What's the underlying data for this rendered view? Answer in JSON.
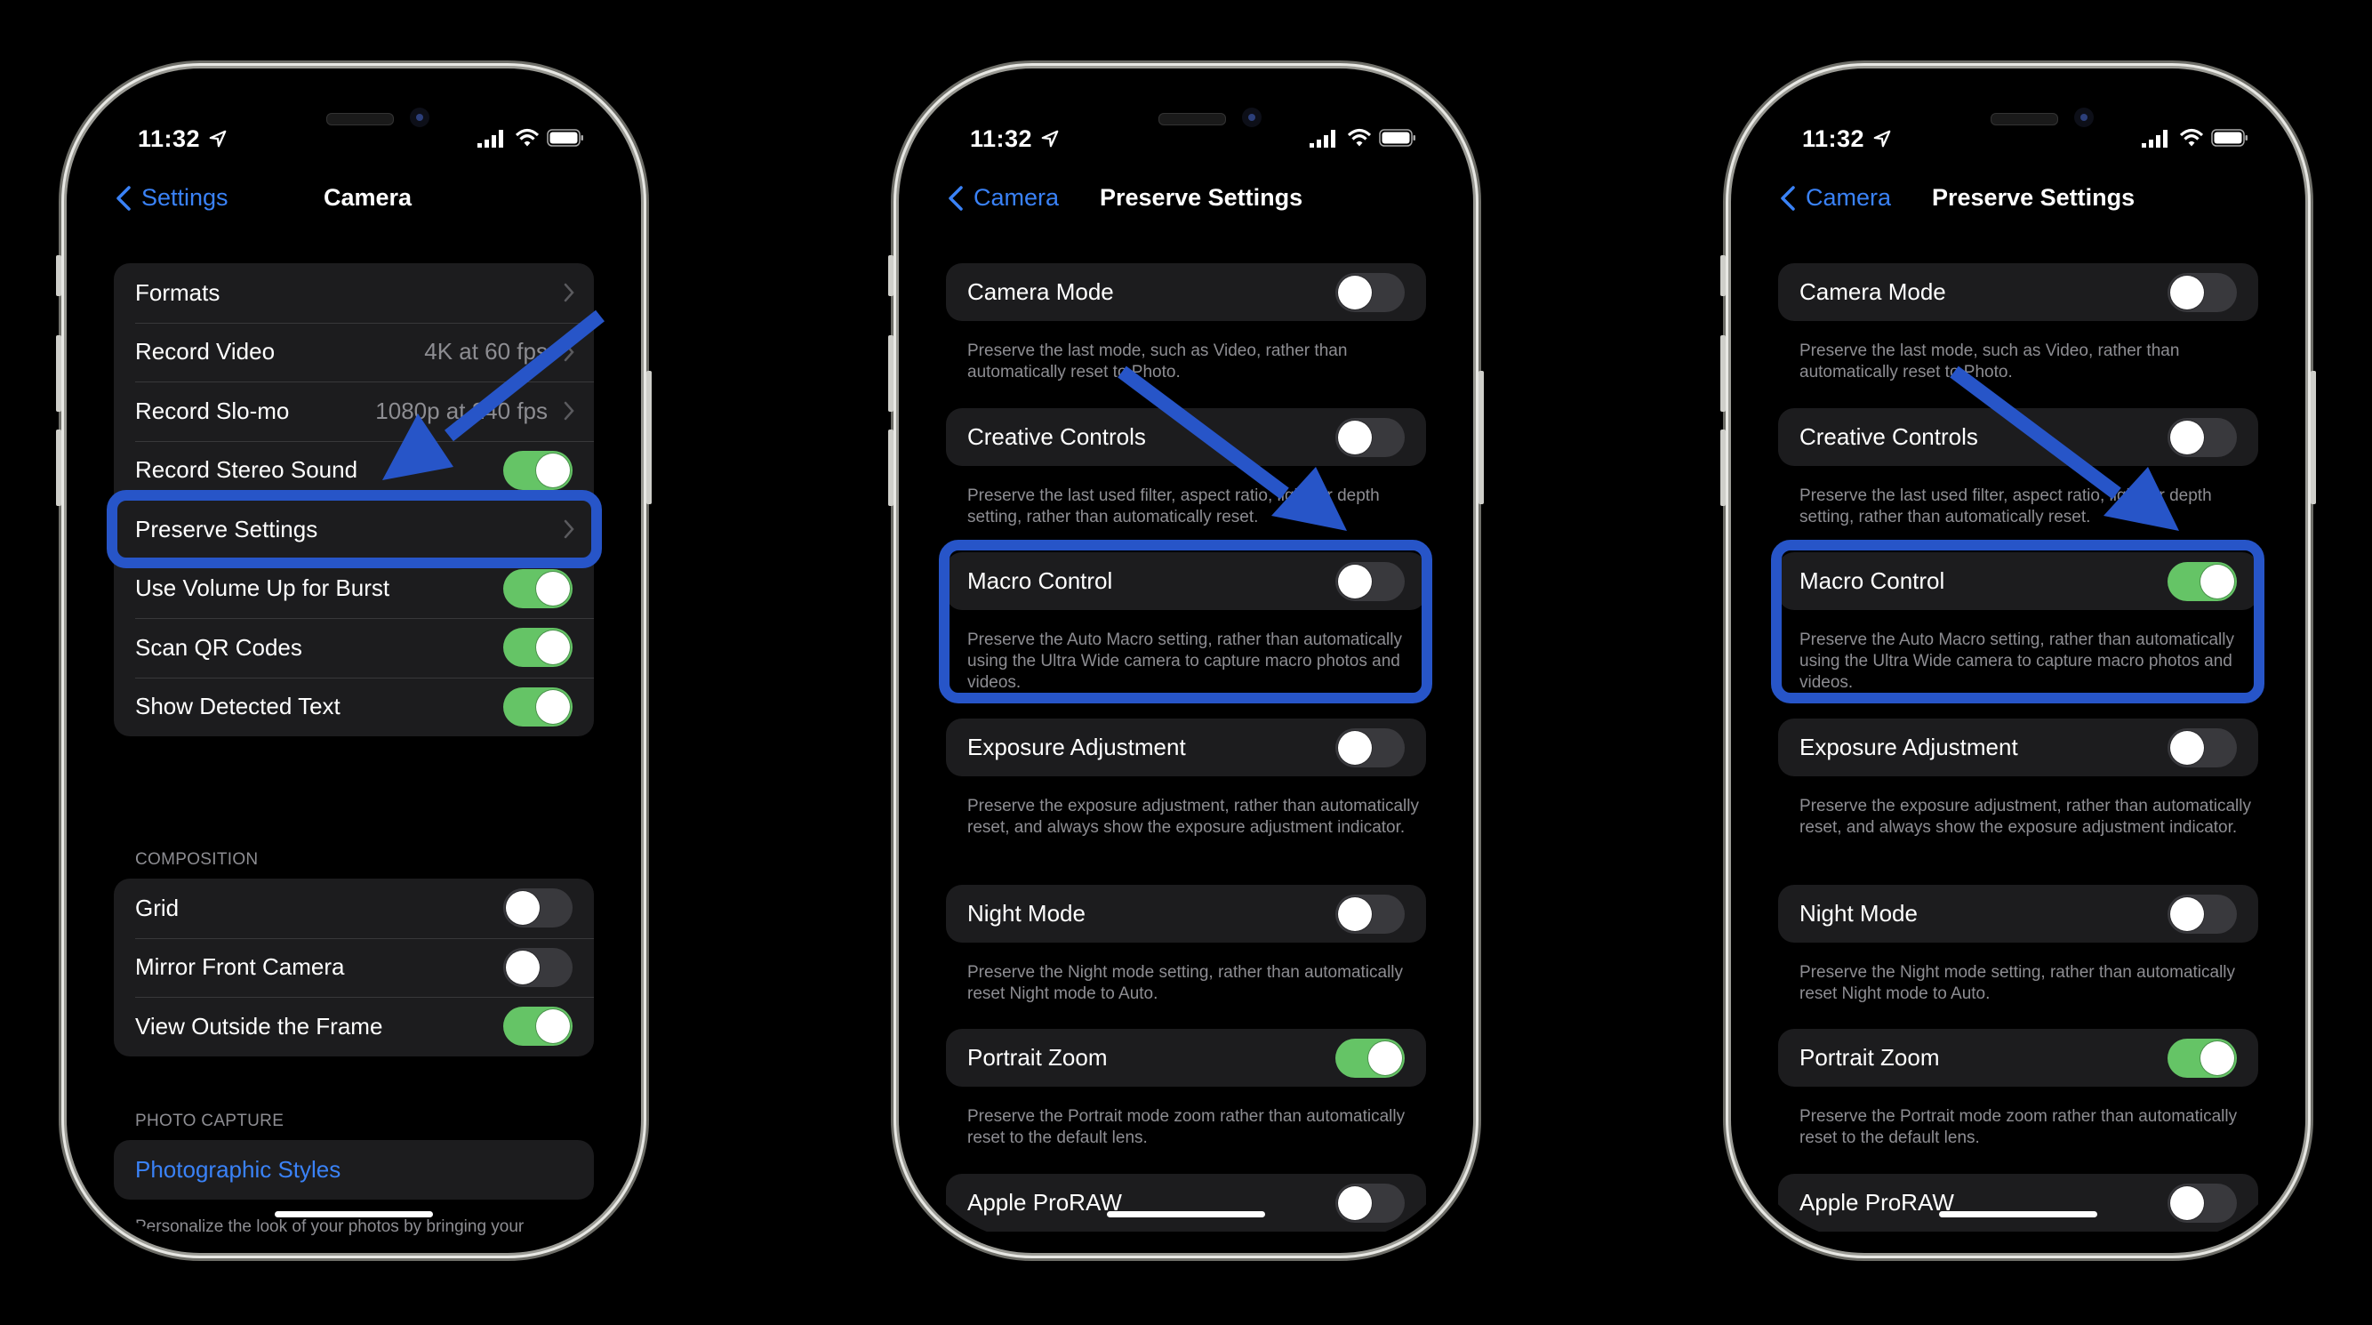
{
  "status_bar": {
    "time": "11:32",
    "location_icon": "location-arrow-icon",
    "signal_icon": "cellular-signal-icon",
    "wifi_icon": "wifi-icon",
    "battery_icon": "battery-icon"
  },
  "colors": {
    "accent_blue": "#3a82f7",
    "toggle_on": "#65c466",
    "toggle_off": "#39393d",
    "annotation_blue": "#2755c8",
    "cell_bg": "#1c1c1e",
    "secondary_text": "#8d8d92"
  },
  "phones": [
    {
      "nav": {
        "back_label": "Settings",
        "title": "Camera"
      },
      "group_main": [
        {
          "label": "Formats",
          "type": "link"
        },
        {
          "label": "Record Video",
          "value": "4K at 60 fps",
          "type": "link"
        },
        {
          "label": "Record Slo-mo",
          "value": "1080p at 240 fps",
          "type": "link"
        },
        {
          "label": "Record Stereo Sound",
          "type": "toggle",
          "on": true
        },
        {
          "label": "Preserve Settings",
          "type": "link",
          "highlighted": true
        },
        {
          "label": "Use Volume Up for Burst",
          "type": "toggle",
          "on": true
        },
        {
          "label": "Scan QR Codes",
          "type": "toggle",
          "on": true
        },
        {
          "label": "Show Detected Text",
          "type": "toggle",
          "on": true
        }
      ],
      "composition_header": "COMPOSITION",
      "group_composition": [
        {
          "label": "Grid",
          "type": "toggle",
          "on": false
        },
        {
          "label": "Mirror Front Camera",
          "type": "toggle",
          "on": false
        },
        {
          "label": "View Outside the Frame",
          "type": "toggle",
          "on": true
        }
      ],
      "photo_capture_header": "PHOTO CAPTURE",
      "photographic_styles_label": "Photographic Styles",
      "photographic_styles_footer": "Personalize the look of your photos by bringing your preferences into the capture. Photographic Styles use advanced scene understanding to apply the right amount of adjustments to different parts of the"
    },
    {
      "nav": {
        "back_label": "Camera",
        "title": "Preserve Settings"
      },
      "settings": [
        {
          "label": "Camera Mode",
          "on": false,
          "footer": "Preserve the last mode, such as Video, rather than automatically reset to Photo."
        },
        {
          "label": "Creative Controls",
          "on": false,
          "footer": "Preserve the last used filter, aspect ratio, light, or depth setting, rather than automatically reset."
        },
        {
          "label": "Macro Control",
          "on": false,
          "highlighted": true,
          "footer": "Preserve the Auto Macro setting, rather than automatically using the Ultra Wide camera to capture macro photos and videos."
        },
        {
          "label": "Exposure Adjustment",
          "on": false,
          "footer": "Preserve the exposure adjustment, rather than automatically reset, and always show the exposure adjustment indicator."
        },
        {
          "label": "Night Mode",
          "on": false,
          "footer": "Preserve the Night mode setting, rather than automatically reset Night mode to Auto."
        },
        {
          "label": "Portrait Zoom",
          "on": true,
          "footer": "Preserve the Portrait mode zoom rather than automatically reset to the default lens."
        },
        {
          "label": "Apple ProRAW",
          "on": false
        }
      ]
    },
    {
      "nav": {
        "back_label": "Camera",
        "title": "Preserve Settings"
      },
      "settings": [
        {
          "label": "Camera Mode",
          "on": false,
          "footer": "Preserve the last mode, such as Video, rather than automatically reset to Photo."
        },
        {
          "label": "Creative Controls",
          "on": false,
          "footer": "Preserve the last used filter, aspect ratio, light, or depth setting, rather than automatically reset."
        },
        {
          "label": "Macro Control",
          "on": true,
          "highlighted": true,
          "footer": "Preserve the Auto Macro setting, rather than automatically using the Ultra Wide camera to capture macro photos and videos."
        },
        {
          "label": "Exposure Adjustment",
          "on": false,
          "footer": "Preserve the exposure adjustment, rather than automatically reset, and always show the exposure adjustment indicator."
        },
        {
          "label": "Night Mode",
          "on": false,
          "footer": "Preserve the Night mode setting, rather than automatically reset Night mode to Auto."
        },
        {
          "label": "Portrait Zoom",
          "on": true,
          "footer": "Preserve the Portrait mode zoom rather than automatically reset to the default lens."
        },
        {
          "label": "Apple ProRAW",
          "on": false
        }
      ]
    }
  ]
}
